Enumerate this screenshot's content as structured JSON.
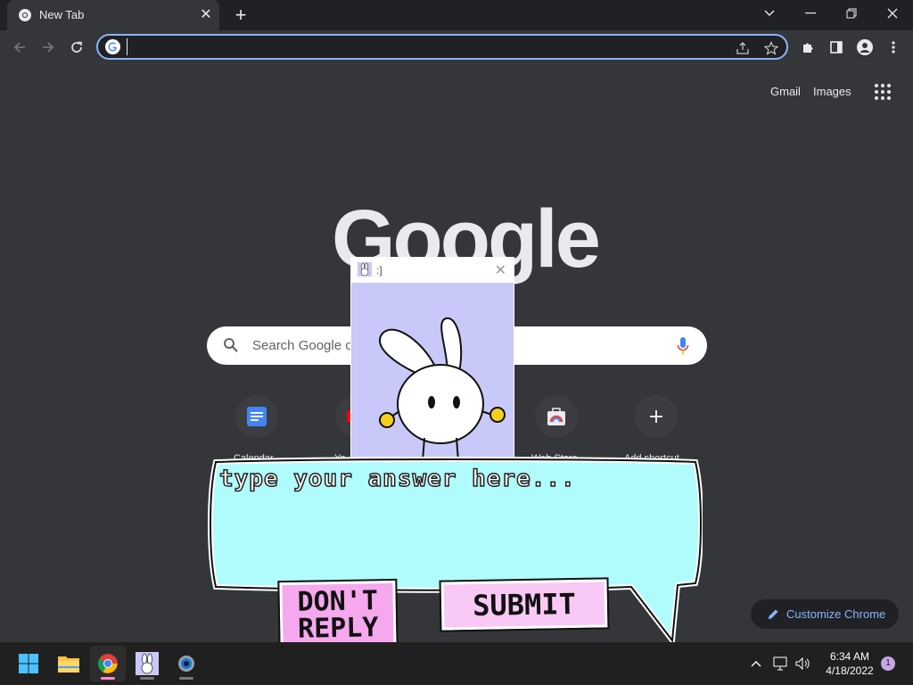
{
  "browser": {
    "tab_title": "New Tab",
    "omnibox_value": ""
  },
  "ntp": {
    "links": [
      "Gmail",
      "Images"
    ],
    "logo_text": "Google",
    "search_placeholder": "Search Google o",
    "shortcuts": [
      {
        "label": "Calendar",
        "icon": "list-icon"
      },
      {
        "label": "Yo",
        "icon": "youtube-icon"
      },
      {
        "label": "Web Store",
        "icon": "web-store-icon"
      },
      {
        "label": "Add shortcut",
        "icon": "plus-icon"
      }
    ],
    "customize_label": "Customize Chrome"
  },
  "popup": {
    "title": ":]"
  },
  "answer_box": {
    "placeholder": "type your answer here...",
    "value": ""
  },
  "buttons": {
    "dont_reply_line1": "DON'T",
    "dont_reply_line2": "REPLY",
    "submit": "SUBMIT"
  },
  "taskbar": {
    "time": "6:34 AM",
    "date": "4/18/2022",
    "notification_count": "1"
  },
  "colors": {
    "accent": "#8ab4f8",
    "bubble": "#b0fcfc",
    "popup_bg": "#c8c9f8",
    "button_pink": "#f5a8ee"
  }
}
